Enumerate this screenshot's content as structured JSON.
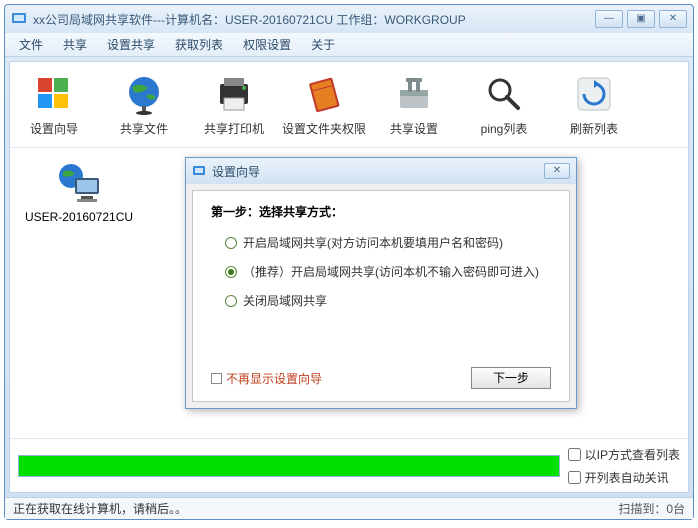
{
  "window": {
    "title": "xx公司局域网共享软件---计算机名：USER-20160721CU  工作组：WORKGROUP",
    "controls": {
      "min": "—",
      "max": "▣",
      "close": "✕"
    }
  },
  "menu": {
    "items": [
      "文件",
      "共享",
      "设置共享",
      "获取列表",
      "权限设置",
      "关于"
    ]
  },
  "toolbar": {
    "items": [
      {
        "key": "wizard",
        "label": "设置向导"
      },
      {
        "key": "share-files",
        "label": "共享文件"
      },
      {
        "key": "share-printer",
        "label": "共享打印机"
      },
      {
        "key": "folder-perm",
        "label": "设置文件夹权限"
      },
      {
        "key": "share-settings",
        "label": "共享设置"
      },
      {
        "key": "ping-list",
        "label": "ping列表"
      },
      {
        "key": "refresh-list",
        "label": "刷新列表"
      }
    ]
  },
  "computers": [
    {
      "name": "USER-20160721CU"
    }
  ],
  "bottom": {
    "check_ip_label": "以IP方式查看列表",
    "check_auto_label": "开列表自动关讯"
  },
  "statusbar": {
    "left": "正在获取在线计算机，请稍后。。",
    "right": "扫描到：0台"
  },
  "dialog": {
    "title": "设置向导",
    "step": "第一步：选择共享方式：",
    "opt1": "开启局域网共享(对方访问本机要填用户名和密码)",
    "opt2": "（推荐）开启局域网共享(访问本机不输入密码即可进入)",
    "opt3": "关闭局域网共享",
    "no_show": "不再显示设置向导",
    "next": "下一步"
  }
}
